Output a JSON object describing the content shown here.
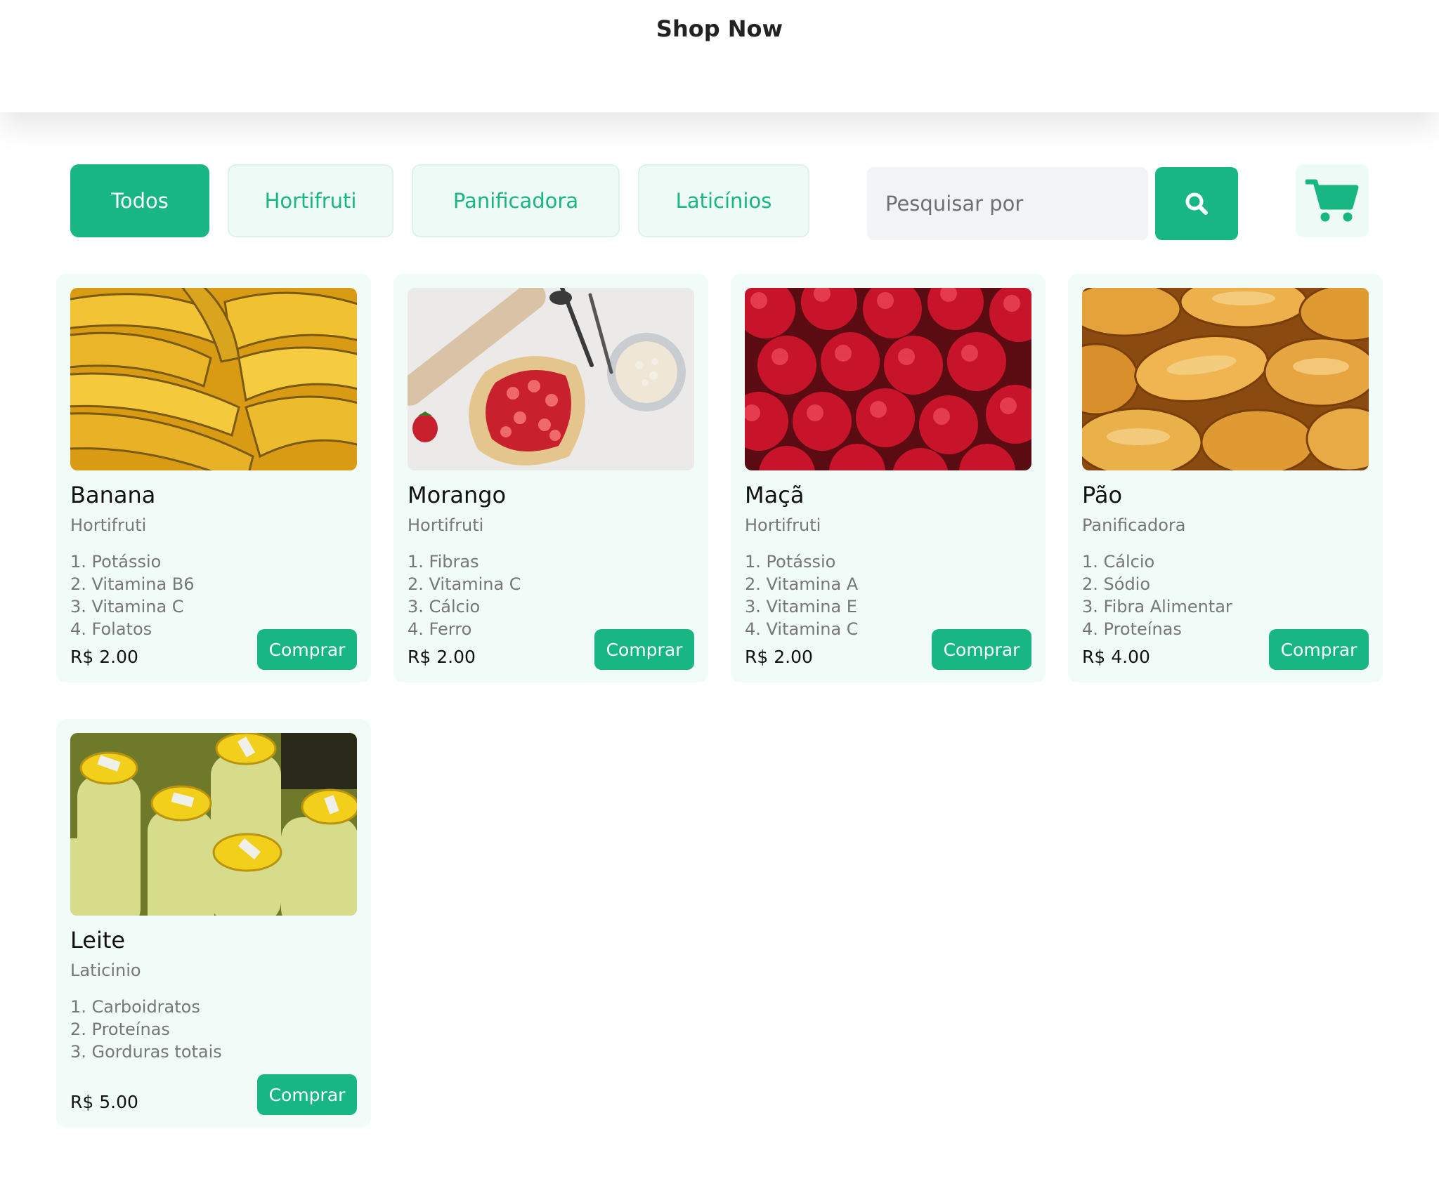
{
  "header": {
    "title": "Shop Now"
  },
  "filters": [
    {
      "label": "Todos",
      "active": true
    },
    {
      "label": "Hortifruti",
      "active": false
    },
    {
      "label": "Panificadora",
      "active": false
    },
    {
      "label": "Laticínios",
      "active": false
    }
  ],
  "search": {
    "placeholder": "Pesquisar por",
    "value": "",
    "button_icon": "search-icon"
  },
  "cart": {
    "icon": "cart-icon"
  },
  "colors": {
    "accent": "#18b682",
    "card_bg": "#f1fbf7",
    "muted_text": "#777777"
  },
  "products": [
    {
      "name": "Banana",
      "category": "Hortifruti",
      "nutrients": [
        "1. Potássio",
        "2. Vitamina B6",
        "3. Vitamina C",
        "4. Folatos"
      ],
      "price": "R$ 2.00",
      "buy_label": "Comprar",
      "image": "bananas-photo"
    },
    {
      "name": "Morango",
      "category": "Hortifruti",
      "nutrients": [
        "1. Fibras",
        "2. Vitamina C",
        "3. Cálcio",
        "4. Ferro"
      ],
      "price": "R$ 2.00",
      "buy_label": "Comprar",
      "image": "strawberry-tart-photo"
    },
    {
      "name": "Maçã",
      "category": "Hortifruti",
      "nutrients": [
        "1. Potássio",
        "2. Vitamina A",
        "3. Vitamina E",
        "4. Vitamina C"
      ],
      "price": "R$ 2.00",
      "buy_label": "Comprar",
      "image": "apples-photo"
    },
    {
      "name": "Pão",
      "category": "Panificadora",
      "nutrients": [
        "1. Cálcio",
        "2. Sódio",
        "3. Fibra Alimentar",
        "4. Proteínas"
      ],
      "price": "R$ 4.00",
      "buy_label": "Comprar",
      "image": "bread-photo"
    },
    {
      "name": "Leite",
      "category": "Laticinio",
      "nutrients": [
        "1. Carboidratos",
        "2. Proteínas",
        "3. Gorduras totais"
      ],
      "price": "R$ 5.00",
      "buy_label": "Comprar",
      "image": "milk-bottles-photo"
    }
  ]
}
